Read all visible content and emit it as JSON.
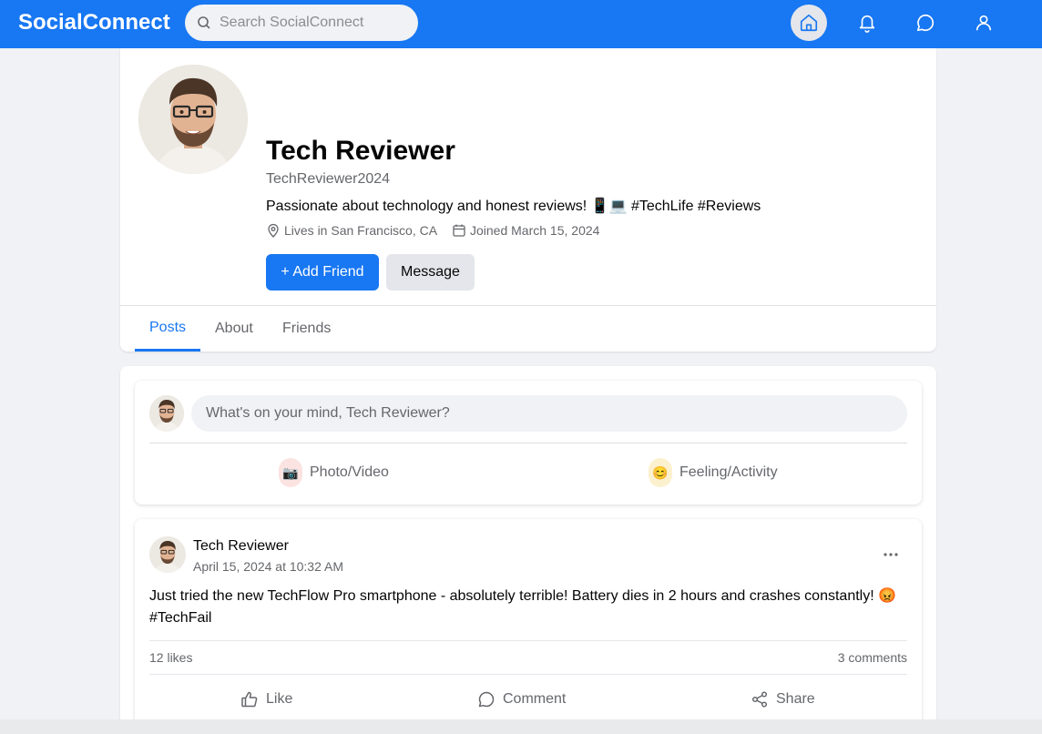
{
  "app": {
    "brand": "SocialConnect"
  },
  "search": {
    "placeholder": "Search SocialConnect"
  },
  "nav": {
    "items": [
      {
        "icon": "home-icon",
        "active": true
      },
      {
        "icon": "bell-icon",
        "active": false
      },
      {
        "icon": "message-icon",
        "active": false
      },
      {
        "icon": "user-icon",
        "active": false
      }
    ]
  },
  "profile": {
    "name": "Tech Reviewer",
    "handle": "TechReviewer2024",
    "bio": "Passionate about technology and honest reviews! 📱💻 #TechLife #Reviews",
    "location": "Lives in San Francisco, CA",
    "joined": "Joined March 15, 2024",
    "add_friend_label": "+ Add Friend",
    "message_label": "Message"
  },
  "tabs": [
    {
      "label": "Posts",
      "active": true
    },
    {
      "label": "About",
      "active": false
    },
    {
      "label": "Friends",
      "active": false
    }
  ],
  "composer": {
    "placeholder": "What's on your mind, Tech Reviewer?",
    "photo_label": "Photo/Video",
    "photo_emoji": "📷",
    "feeling_label": "Feeling/Activity",
    "feeling_emoji": "😊"
  },
  "post": {
    "author": "Tech Reviewer",
    "time": "April 15, 2024 at 10:32 AM",
    "text": "Just tried the new TechFlow Pro smartphone - absolutely terrible! Battery dies in 2 hours and crashes constantly! 😡 #TechFail",
    "likes": "12 likes",
    "comments": "3 comments",
    "like_label": "Like",
    "comment_label": "Comment",
    "share_label": "Share"
  },
  "colors": {
    "brand": "#1877f2",
    "background": "#f0f2f5",
    "muted_text": "#65676b"
  }
}
